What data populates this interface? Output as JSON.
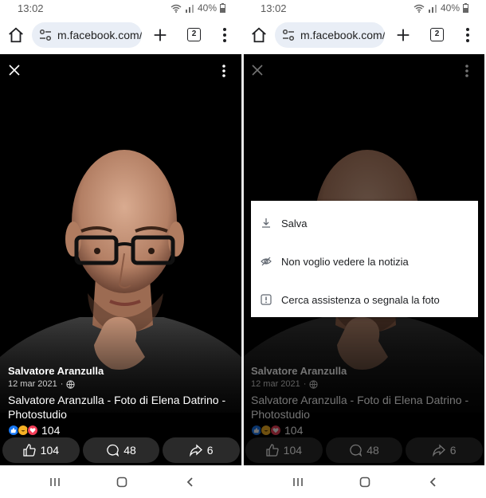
{
  "status_bar": {
    "time": "13:02",
    "battery": "40%"
  },
  "browser": {
    "url": "m.facebook.com/",
    "tab_count": "2"
  },
  "post": {
    "author": "Salvatore Aranzulla",
    "date": "12 mar 2021",
    "dot": "·",
    "title": "Salvatore Aranzulla - Foto di Elena Datrino - Photostudio",
    "reactions_count": "104",
    "like_count": "104",
    "comment_count": "48",
    "share_count": "6"
  },
  "menu": {
    "items": [
      {
        "label": "Salva",
        "icon": "download-icon"
      },
      {
        "label": "Non voglio vedere la notizia",
        "icon": "eye-off-icon"
      },
      {
        "label": "Cerca assistenza o segnala la foto",
        "icon": "report-icon"
      }
    ]
  },
  "colors": {
    "url_pill": "#e9eef6",
    "viewer_bg": "#000000",
    "action_button": "#2a2a2a",
    "like_blue": "#1877f2",
    "love_red": "#f33e58",
    "haha_yellow": "#f7b125"
  }
}
